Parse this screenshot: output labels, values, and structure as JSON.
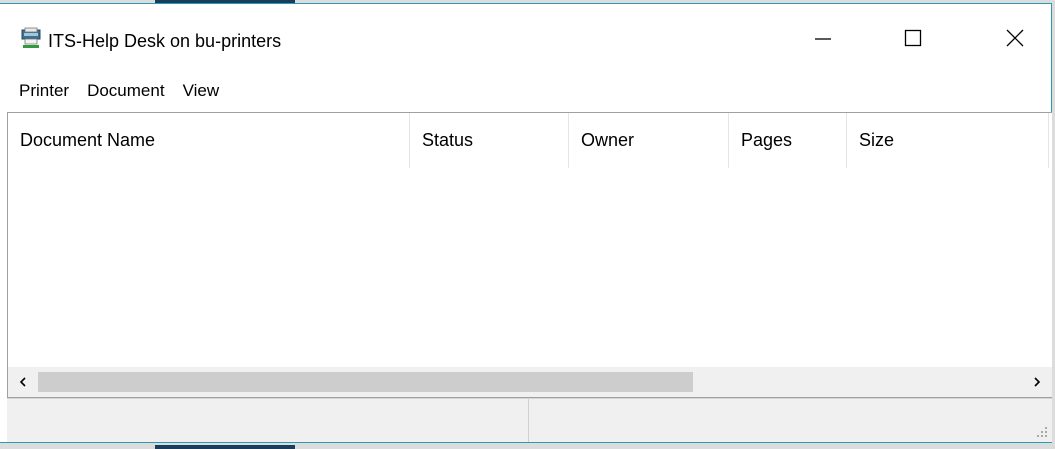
{
  "window": {
    "title": "ITS-Help Desk on bu-printers",
    "icon": "printer-queue-icon",
    "controls": {
      "minimize": "minimize-icon",
      "maximize": "maximize-icon",
      "close": "close-icon"
    }
  },
  "menu": {
    "items": [
      "Printer",
      "Document",
      "View"
    ]
  },
  "queue": {
    "columns": [
      "Document Name",
      "Status",
      "Owner",
      "Pages",
      "Size"
    ],
    "rows": []
  },
  "scrollbar": {
    "left_icon": "chevron-left-icon",
    "right_icon": "chevron-right-icon"
  },
  "colors": {
    "window_border": "#2b9bb5",
    "scroll_thumb": "#cdcdcd",
    "statusbar_bg": "#f0f0f0"
  }
}
